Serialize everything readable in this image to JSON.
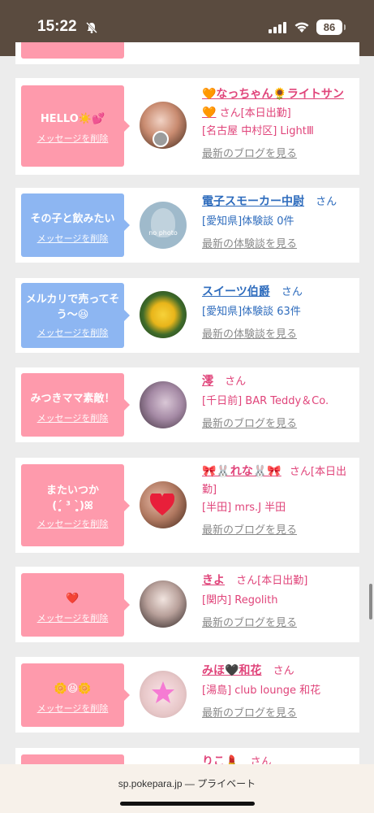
{
  "status": {
    "time": "15:22",
    "battery": "86",
    "icons": [
      "bell-muted-icon",
      "signal-icon",
      "wifi-icon",
      "battery-icon"
    ]
  },
  "entries": [
    {
      "message": "HELLO☀️💕",
      "delete_label": "メッセージを削除",
      "bubble_color": "pink",
      "name": "🧡なっちゃん🌻ライトサン🧡",
      "san": "さん[本日出勤]",
      "meta": "[名古屋 中村区] LightⅢ",
      "latest": "最新のブログを見る"
    },
    {
      "message": "その子と飲みたい",
      "delete_label": "メッセージを削除",
      "bubble_color": "blue",
      "name": "電子スモーカー中尉",
      "san": "さん",
      "meta": "[愛知県]体験談 0件",
      "latest": "最新の体験談を見る"
    },
    {
      "message": "メルカリで売ってそう〜😆",
      "delete_label": "メッセージを削除",
      "bubble_color": "blue",
      "name": "スイーツ伯爵",
      "san": "さん",
      "meta": "[愛知県]体験談 63件",
      "latest": "最新の体験談を見る"
    },
    {
      "message": "みつきママ素敵！",
      "delete_label": "メッセージを削除",
      "bubble_color": "pink",
      "name": "澪",
      "san": "さん",
      "meta": "[千日前] BAR Teddy＆Co.",
      "latest": "最新のブログを見る"
    },
    {
      "message": "またいつか\n(ˊ̥̥̥̥̥ ³ ˋ̥̥̥̥̥)ꕤ",
      "delete_label": "メッセージを削除",
      "bubble_color": "pink",
      "name": "🎀🐰れな🐰🎀",
      "san": "さん[本日出勤]",
      "meta": "[半田] mrs.J 半田",
      "latest": "最新のブログを見る"
    },
    {
      "message": "❤️",
      "delete_label": "メッセージを削除",
      "bubble_color": "pink",
      "name": "きよ",
      "san": "さん[本日出勤]",
      "meta": "[関内] Regolith",
      "latest": "最新のブログを見る"
    },
    {
      "message": "🌼😆🌼",
      "delete_label": "メッセージを削除",
      "bubble_color": "pink",
      "name": "みほ🖤和花",
      "san": "さん",
      "meta": "[湯島] club lounge 和花",
      "latest": "最新のブログを見る"
    },
    {
      "name": "りこ💄",
      "san": "さん"
    }
  ],
  "avatar_photo_label": "no photo",
  "url_bar": {
    "text": "sp.pokepara.jp — プライベート"
  }
}
